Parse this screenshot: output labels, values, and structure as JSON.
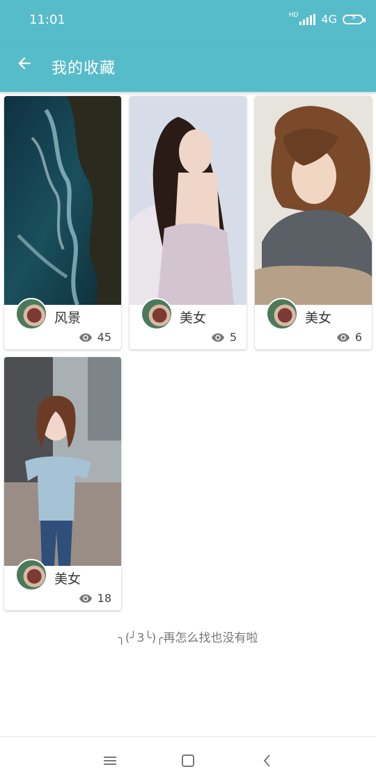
{
  "status_bar": {
    "time": "11:01",
    "hd_label": "HD",
    "network": "4G"
  },
  "header": {
    "title": "我的收藏",
    "back_icon": "arrow-left-icon",
    "background_color": "#57bcc9"
  },
  "cards": [
    {
      "title": "风景",
      "views": "45",
      "image": "aerial-ocean-waves-rocks"
    },
    {
      "title": "美女",
      "views": "5",
      "image": "woman-long-dark-hair"
    },
    {
      "title": "美女",
      "views": "6",
      "image": "woman-short-hair-scarf"
    },
    {
      "title": "美女",
      "views": "18",
      "image": "woman-blue-top-jeans"
    }
  ],
  "end_message": "╮(╯3╰)╭再怎么找也没有啦",
  "nav": {
    "menu_icon": "menu-icon",
    "home_icon": "square-icon",
    "back_icon": "chevron-left-icon"
  }
}
